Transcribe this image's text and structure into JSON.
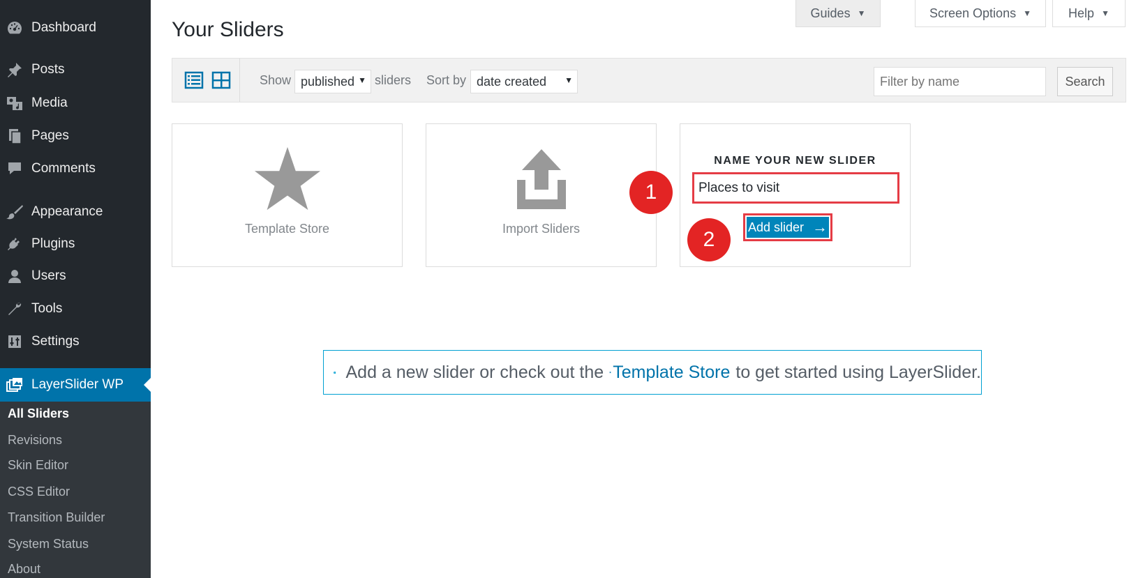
{
  "sidebar": {
    "menu": [
      {
        "label": "Dashboard",
        "icon": "dashboard-icon"
      },
      {
        "label": "Posts",
        "icon": "pushpin-icon"
      },
      {
        "label": "Media",
        "icon": "media-icon"
      },
      {
        "label": "Pages",
        "icon": "pages-icon"
      },
      {
        "label": "Comments",
        "icon": "comment-icon"
      },
      {
        "label": "Appearance",
        "icon": "paintbrush-icon"
      },
      {
        "label": "Plugins",
        "icon": "plugin-icon"
      },
      {
        "label": "Users",
        "icon": "user-icon"
      },
      {
        "label": "Tools",
        "icon": "wrench-icon"
      },
      {
        "label": "Settings",
        "icon": "settings-icon"
      },
      {
        "label": "LayerSlider WP",
        "icon": "layerslider-icon"
      }
    ],
    "submenu": [
      "All Sliders",
      "Revisions",
      "Skin Editor",
      "CSS Editor",
      "Transition Builder",
      "System Status",
      "About"
    ]
  },
  "header": {
    "title": "Your Sliders",
    "tabs": {
      "guides": "Guides",
      "screen_options": "Screen Options",
      "help": "Help"
    }
  },
  "filter_bar": {
    "show_label": "Show",
    "show_value": "published",
    "sliders_label": "sliders",
    "sort_label": "Sort by",
    "sort_value": "date created",
    "filter_placeholder": "Filter by name",
    "search_label": "Search"
  },
  "cards": {
    "template_store": "Template Store",
    "import": "Import Sliders",
    "new_slider_heading": "NAME YOUR NEW SLIDER",
    "new_slider_value": "Places to visit",
    "add_slider_label": "Add slider",
    "add_slider_arrow": "→"
  },
  "annotations": {
    "step1": "1",
    "step2": "2"
  },
  "notice": {
    "before": "Add a new slider or check out the",
    "link": "Template Store",
    "after": "to get started using LayerSlider."
  },
  "colors": {
    "sidebar_bg": "#23282d",
    "submenu_bg": "#32373c",
    "accent": "#0073aa",
    "button_blue": "#0085ba",
    "annotation_red": "#e32424"
  }
}
